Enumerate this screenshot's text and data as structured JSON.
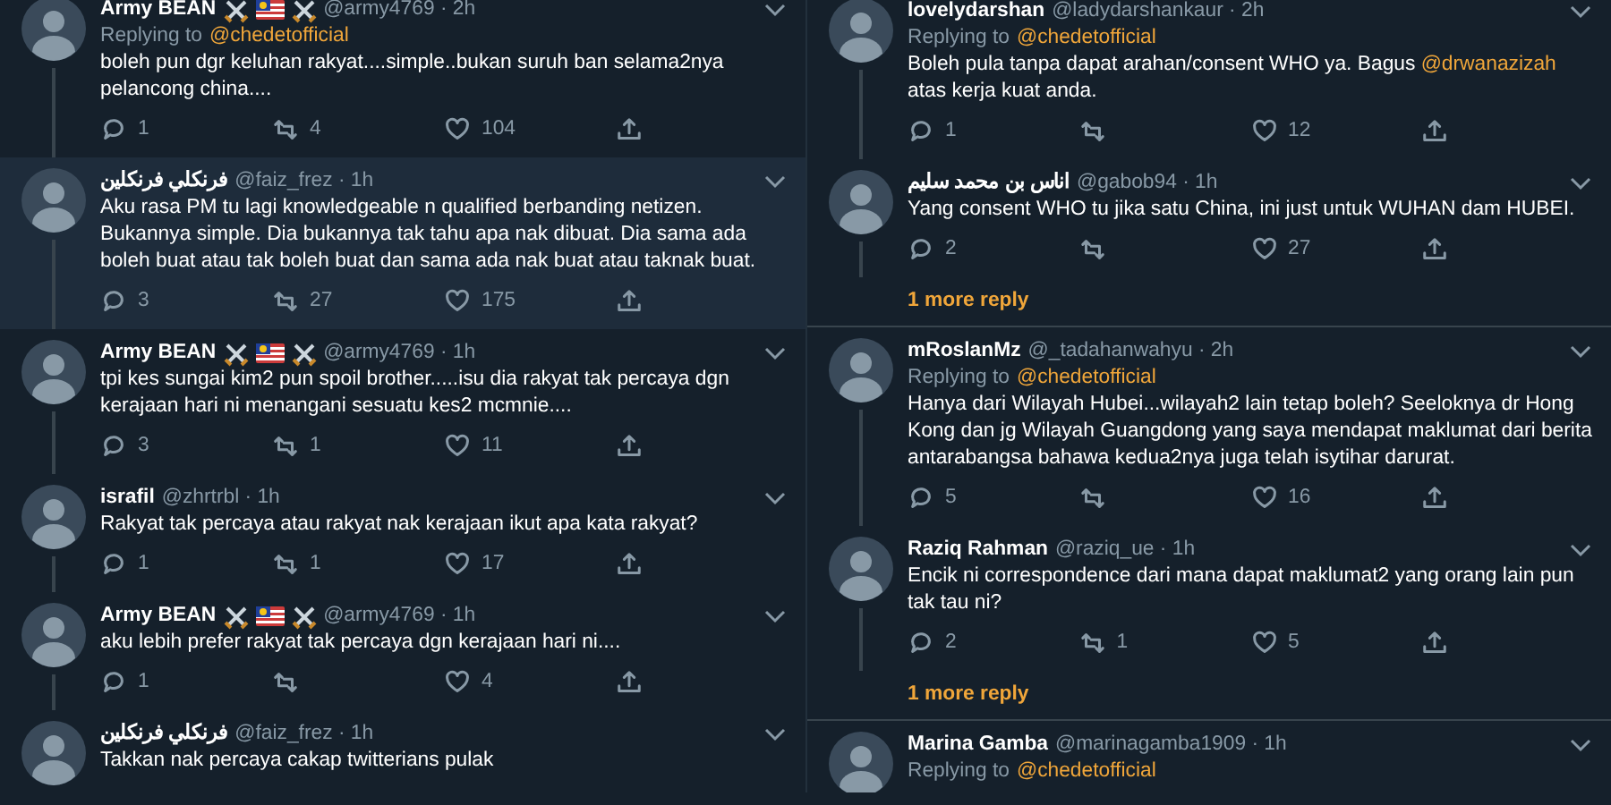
{
  "columns": [
    {
      "tweets": [
        {
          "name": "Army BEAN",
          "emoji_badges": true,
          "meta": "@army4769 · 2h",
          "replying_to": "Replying to",
          "replying_handle": "@chedetofficial",
          "highlighted": false,
          "thread_line": true,
          "parts": [
            {
              "kind": "plain",
              "text": "boleh pun dgr keluhan rakyat....simple..bukan suruh ban selama2nya pelancong china...."
            }
          ],
          "actions": {
            "replies": "1",
            "retweets": "4",
            "likes": "104"
          }
        },
        {
          "name": "فرنكلي فرنكلين",
          "emoji_badges": false,
          "meta": "@faiz_frez · 1h",
          "highlighted": true,
          "thread_line": true,
          "parts": [
            {
              "kind": "plain",
              "text": "Aku rasa PM tu lagi knowledgeable n qualified berbanding netizen. Bukannya simple. Dia bukannya tak tahu apa nak dibuat. Dia sama ada boleh buat atau tak boleh buat dan sama ada nak buat atau taknak buat."
            }
          ],
          "actions": {
            "replies": "3",
            "retweets": "27",
            "likes": "175"
          }
        },
        {
          "name": "Army BEAN",
          "emoji_badges": true,
          "meta": "@army4769 · 1h",
          "highlighted": false,
          "thread_line": true,
          "parts": [
            {
              "kind": "plain",
              "text": "tpi kes sungai kim2 pun spoil brother.....isu dia rakyat tak percaya dgn kerajaan hari ni menangani sesuatu kes2 mcmnie...."
            }
          ],
          "actions": {
            "replies": "3",
            "retweets": "1",
            "likes": "11"
          }
        },
        {
          "name": "israfil",
          "emoji_badges": false,
          "meta": "@zhrtrbl · 1h",
          "highlighted": false,
          "thread_line": true,
          "parts": [
            {
              "kind": "plain",
              "text": "Rakyat tak percaya atau rakyat nak kerajaan ikut apa kata rakyat?"
            }
          ],
          "actions": {
            "replies": "1",
            "retweets": "1",
            "likes": "17"
          }
        },
        {
          "name": "Army BEAN",
          "emoji_badges": true,
          "meta": "@army4769 · 1h",
          "highlighted": false,
          "thread_line": true,
          "parts": [
            {
              "kind": "plain",
              "text": "aku lebih prefer rakyat tak percaya dgn kerajaan hari ni...."
            }
          ],
          "actions": {
            "replies": "1",
            "likes": "4"
          }
        },
        {
          "name": "فرنكلي فرنكلين",
          "emoji_badges": false,
          "meta": "@faiz_frez · 1h",
          "highlighted": false,
          "thread_line": false,
          "parts": [
            {
              "kind": "plain",
              "text": "Takkan nak percaya cakap twitterians pulak"
            }
          ]
        }
      ]
    },
    {
      "tweets": [
        {
          "name": "lovelydarshan",
          "emoji_badges": false,
          "meta": "@ladydarshankaur · 2h",
          "replying_to": "Replying to",
          "replying_handle": "@chedetofficial",
          "highlighted": false,
          "thread_line": true,
          "parts": [
            {
              "kind": "plain",
              "text": "Boleh pula tanpa dapat arahan/consent WHO ya. Bagus "
            },
            {
              "kind": "mention",
              "text": "@drwanazizah"
            },
            {
              "kind": "plain",
              "text": " atas kerja kuat anda."
            }
          ],
          "actions": {
            "replies": "1",
            "likes": "12"
          }
        },
        {
          "name": "اناس بن محمد سليم",
          "emoji_badges": false,
          "meta": "@gabob94 · 1h",
          "highlighted": false,
          "thread_line": true,
          "parts": [
            {
              "kind": "plain",
              "text": "Yang consent WHO tu jika satu China, ini just untuk WUHAN dam HUBEI."
            }
          ],
          "actions": {
            "replies": "2",
            "likes": "27"
          },
          "more_replies": "1 more reply"
        },
        {
          "name": "mRoslanMz",
          "emoji_badges": false,
          "meta": "@_tadahanwahyu · 2h",
          "replying_to": "Replying to",
          "replying_handle": "@chedetofficial",
          "highlighted": false,
          "thread_line": true,
          "parts": [
            {
              "kind": "plain",
              "text": "Hanya dari Wilayah Hubei...wilayah2 lain tetap boleh? Seeloknya dr Hong Kong dan jg Wilayah Guangdong yang saya mendapat maklumat dari berita antarabangsa bahawa kedua2nya juga telah isytihar darurat."
            }
          ],
          "actions": {
            "replies": "5",
            "likes": "16"
          }
        },
        {
          "name": "Raziq Rahman",
          "emoji_badges": false,
          "meta": "@raziq_ue · 1h",
          "highlighted": false,
          "thread_line": true,
          "parts": [
            {
              "kind": "plain",
              "text": "Encik ni correspondence dari mana dapat maklumat2 yang orang lain pun tak tau ni?"
            }
          ],
          "actions": {
            "replies": "2",
            "retweets": "1",
            "likes": "5"
          },
          "more_replies": "1 more reply"
        },
        {
          "name": "Marina Gamba",
          "emoji_badges": false,
          "meta": "@marinagamba1909 · 1h",
          "replying_to": "Replying to",
          "replying_handle": "@chedetofficial",
          "highlighted": false,
          "thread_line": false
        }
      ]
    }
  ]
}
